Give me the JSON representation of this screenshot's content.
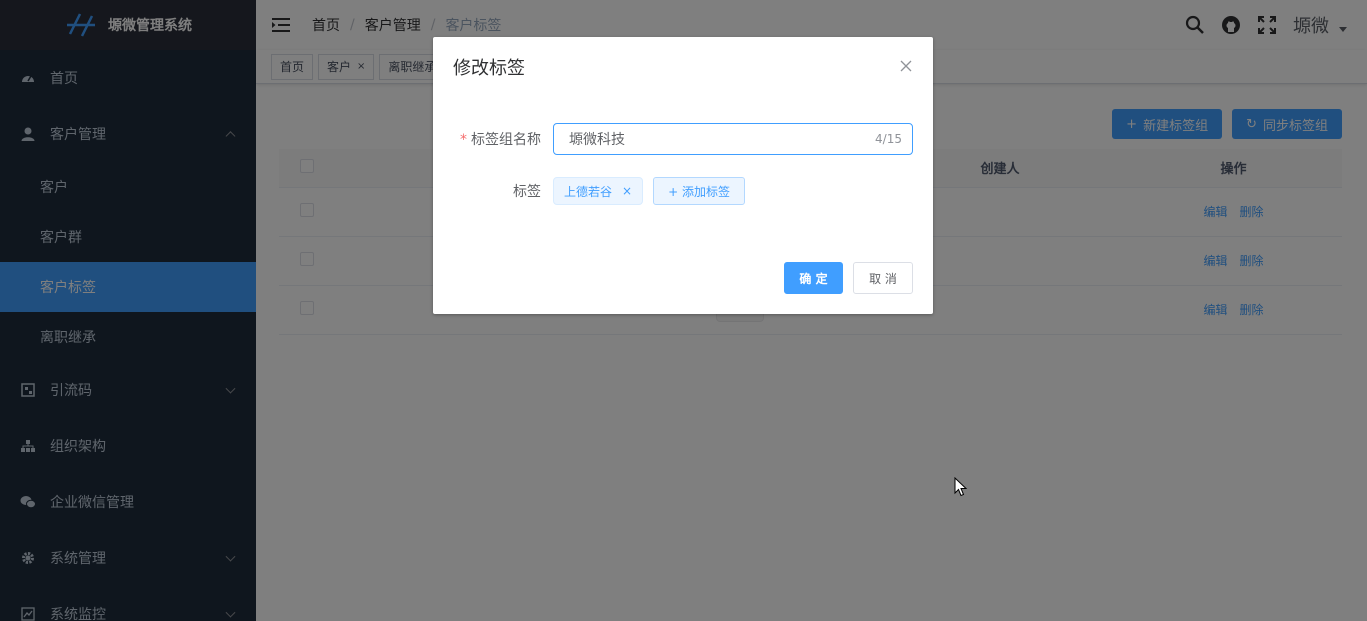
{
  "app": {
    "title": "塬微管理系统"
  },
  "sidebar": {
    "items": [
      {
        "label": "首页",
        "icon": "dashboard-icon"
      },
      {
        "label": "客户管理",
        "icon": "user-icon",
        "expanded": true,
        "children": [
          "客户",
          "客户群",
          "客户标签",
          "离职继承"
        ],
        "active_child": "客户标签"
      },
      {
        "label": "引流码",
        "icon": "qrcode-icon"
      },
      {
        "label": "组织架构",
        "icon": "tree-icon"
      },
      {
        "label": "企业微信管理",
        "icon": "wechat-icon"
      },
      {
        "label": "系统管理",
        "icon": "gear-icon"
      },
      {
        "label": "系统监控",
        "icon": "monitor-icon"
      }
    ]
  },
  "header": {
    "breadcrumb": [
      "首页",
      "客户管理",
      "客户标签"
    ],
    "username": "塬微"
  },
  "tags_view": [
    "首页",
    "客户",
    "离职继承"
  ],
  "toolbar": {
    "new_group": "新建标签组",
    "sync_group": "同步标签组"
  },
  "table": {
    "headers": {
      "creator": "创建人",
      "ops": "操作"
    },
    "edit": "编辑",
    "delete": "删除",
    "row_count": 3
  },
  "dialog": {
    "title": "修改标签",
    "group_name_label": "标签组名称",
    "group_name_value": "塬微科技",
    "char_count": "4/15",
    "tags_label": "标签",
    "tags": [
      "上德若谷"
    ],
    "add_tag": "+ 添加标签",
    "ok": "确 定",
    "cancel": "取 消"
  },
  "colors": {
    "primary": "#409eff",
    "sidebar_bg": "#1f2d3d",
    "danger": "#f56c6c"
  }
}
